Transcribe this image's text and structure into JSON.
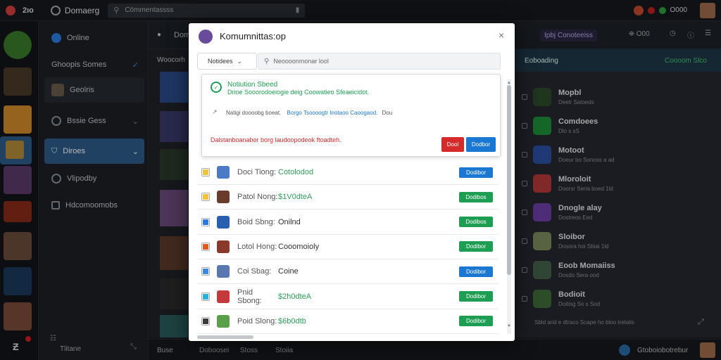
{
  "topbar": {
    "logo_text": "2ıo",
    "app_title": "Domaerg",
    "search_placeholder": "Cömmentassss",
    "status_text": "O000"
  },
  "nav": {
    "items": [
      {
        "label": "Online"
      },
      {
        "label": "Ghoopis Somes"
      },
      {
        "label": "Geolris"
      },
      {
        "label": "Bssie Gess"
      },
      {
        "label": "Diroes"
      },
      {
        "label": "Vlipodby"
      },
      {
        "label": "Hdcomoomobs"
      }
    ],
    "bottom_label": "Tlitane"
  },
  "background": {
    "header_left": "Woocorh",
    "header_center": "Domo",
    "right_header": "Ipbj Conoteeiss",
    "right_subheader": "Eoboading",
    "right_status": "Coooom Slco",
    "right_footer": "Sbld arid e dtraco Scape ho bloo tretalis",
    "bottom_tabs": [
      "Buse",
      "Doboosei",
      "Stoss",
      "Stoiia"
    ],
    "bottom_status": "Gtoboiobotrebur"
  },
  "right_panel": [
    {
      "title": "Mopbl",
      "sub": "Deelr Satoeds",
      "color": "#2d4a2a"
    },
    {
      "title": "Comdoees",
      "sub": "Dlo s sS",
      "color": "#1d8f3a"
    },
    {
      "title": "Motoot",
      "sub": "Doeur bo Sonoss a ad",
      "color": "#2a4fa0"
    },
    {
      "title": "Mloroloit",
      "sub": "Doorsr Seria boed 1ld",
      "color": "#b33a3a"
    },
    {
      "title": "Dnogle alay",
      "sub": "Dostreos Eed",
      "color": "#6b3fa5"
    },
    {
      "title": "Sloibor",
      "sub": "Dosora hoi Sbiai 1ld",
      "color": "#7a8a5a"
    },
    {
      "title": "Eoob Momaiiss",
      "sub": "Dosdo Sera ood",
      "color": "#45604a"
    },
    {
      "title": "Bodioit",
      "sub": "Doitisg So s Sod",
      "color": "#3f6b3a"
    }
  ],
  "modal": {
    "title": "Komumnittas:op",
    "tab_label": "Notidees",
    "search_placeholder": "Neoooonmonar lool",
    "notice_title": "Notiution Sbeed",
    "notice_text": "Drioe Sooorodoeiogie deig Coowatieo Sfeaeicidot.",
    "info_text": "Natigi doooobg boeat.",
    "info_link": "Borgo Tsoooogtr Inotaoo Caoogaod.",
    "info_suffix": "Dou",
    "error_text": "Dalstanboanabor borg laudoopodeok ftoadteh.",
    "error_btn": "Dool",
    "primary_btn": "Dodbor",
    "rows": [
      {
        "name": "Doci Tiong:",
        "status": "Cotolodod",
        "status_color": "#2f9e5a",
        "btn": "Dodibor",
        "btn_style": "blue",
        "icon": "#f2c23a",
        "game": "#4a7bc4"
      },
      {
        "name": "Patol Nong:",
        "status": "$1V0dteA",
        "status_color": "#2f9e5a",
        "btn": "Dodibos",
        "btn_style": "green",
        "icon": "#f2c23a",
        "game": "#6a3b2a"
      },
      {
        "name": "Boid Sbng:",
        "status": "Onilnd",
        "status_color": "#333333",
        "btn": "Dodibos",
        "btn_style": "green",
        "icon": "#2a7ae0",
        "game": "#2a5fb0"
      },
      {
        "name": "Lotol Hong:",
        "status": "Cooomoioly",
        "status_color": "#333333",
        "btn": "Dodibor",
        "btn_style": "green",
        "icon": "#e45a1a",
        "game": "#8a3a2a"
      },
      {
        "name": "Coi Sbag:",
        "status": "Coine",
        "status_color": "#333333",
        "btn": "Dodibor",
        "btn_style": "blue",
        "icon": "#3a8ae0",
        "game": "#5a78b0"
      },
      {
        "name": "Pnid Sbong:",
        "status": "$2h0dteA",
        "status_color": "#2f9e5a",
        "btn": "Dodibor",
        "btn_style": "green",
        "icon": "#25b3d9",
        "game": "#c43a3a"
      },
      {
        "name": "Poid Slong:",
        "status": "$6b0dtb",
        "status_color": "#2f9e5a",
        "btn": "Dodibor",
        "btn_style": "green",
        "icon": "#3a3a3a",
        "game": "#5aa04a"
      }
    ]
  }
}
